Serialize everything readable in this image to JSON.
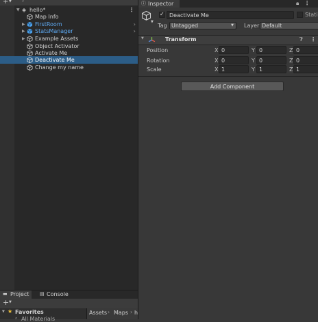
{
  "hierarchy": {
    "scene_name": "hello*",
    "items": [
      {
        "label": "Map Info",
        "prefab": false
      },
      {
        "label": "FirstRoom",
        "prefab": true
      },
      {
        "label": "StatsManager",
        "prefab": true
      },
      {
        "label": "Example Assets",
        "prefab": false
      },
      {
        "label": "Object Activator",
        "prefab": false
      },
      {
        "label": "Activate Me",
        "prefab": false
      },
      {
        "label": "Deactivate Me",
        "prefab": false,
        "selected": true
      },
      {
        "label": "Change my name",
        "prefab": false
      }
    ]
  },
  "inspector": {
    "tab_label": "Inspector",
    "object_name": "Deactivate Me",
    "static_label": "Static",
    "tag_label": "Tag",
    "tag_value": "Untagged",
    "layer_label": "Layer",
    "layer_value": "Default",
    "transform": {
      "title": "Transform",
      "rows": [
        {
          "label": "Position",
          "x": "0",
          "y": "0",
          "z": "0"
        },
        {
          "label": "Rotation",
          "x": "0",
          "y": "0",
          "z": "0"
        },
        {
          "label": "Scale",
          "x": "1",
          "y": "1",
          "z": "1"
        }
      ],
      "axis_x": "X",
      "axis_y": "Y",
      "axis_z": "Z"
    },
    "add_component_label": "Add Component"
  },
  "project": {
    "tab_project": "Project",
    "tab_console": "Console",
    "favorites_label": "Favorites",
    "all_materials_label": "All Materials",
    "breadcrumb": [
      "Assets",
      "Maps",
      "h"
    ]
  },
  "colors": {
    "selection": "#2c5d87",
    "prefab_text": "#5eaaf3"
  }
}
